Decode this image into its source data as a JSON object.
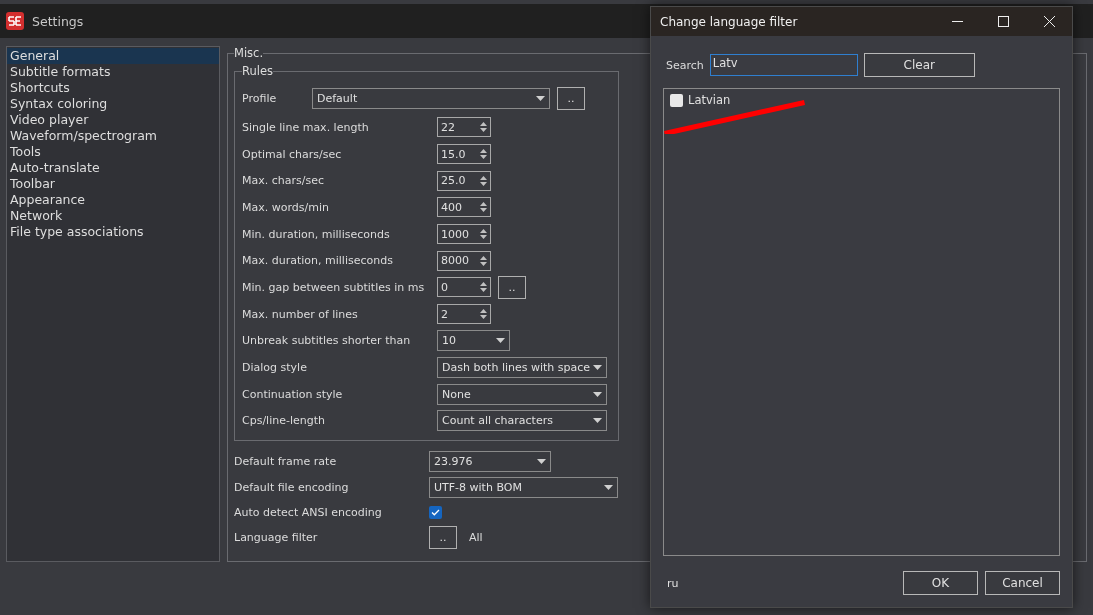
{
  "window": {
    "title": "Settings"
  },
  "sidebar": {
    "items": [
      {
        "label": "General",
        "selected": true
      },
      {
        "label": "Subtitle formats",
        "selected": false
      },
      {
        "label": "Shortcuts",
        "selected": false
      },
      {
        "label": "Syntax coloring",
        "selected": false
      },
      {
        "label": "Video player",
        "selected": false
      },
      {
        "label": "Waveform/spectrogram",
        "selected": false
      },
      {
        "label": "Tools",
        "selected": false
      },
      {
        "label": "Auto-translate",
        "selected": false
      },
      {
        "label": "Toolbar",
        "selected": false
      },
      {
        "label": "Appearance",
        "selected": false
      },
      {
        "label": "Network",
        "selected": false
      },
      {
        "label": "File type associations",
        "selected": false
      }
    ]
  },
  "misc": {
    "title": "Misc.",
    "rules": {
      "title": "Rules",
      "profile": {
        "label": "Profile",
        "value": "Default",
        "button": ".."
      },
      "rows": [
        {
          "kind": "spin",
          "label": "Single line max. length",
          "value": "22"
        },
        {
          "kind": "spin",
          "label": "Optimal chars/sec",
          "value": "15.0"
        },
        {
          "kind": "spin",
          "label": "Max. chars/sec",
          "value": "25.0"
        },
        {
          "kind": "spin",
          "label": "Max. words/min",
          "value": "400"
        },
        {
          "kind": "spin",
          "label": "Min. duration, milliseconds",
          "value": "1000"
        },
        {
          "kind": "spin",
          "label": "Max. duration, milliseconds",
          "value": "8000"
        },
        {
          "kind": "spin",
          "label": "Min. gap between subtitles in ms",
          "value": "0",
          "button": ".."
        },
        {
          "kind": "spin",
          "label": "Max. number of lines",
          "value": "2"
        },
        {
          "kind": "combo-small",
          "label": "Unbreak subtitles shorter than",
          "value": "10"
        },
        {
          "kind": "combo",
          "label": "Dialog style",
          "value": "Dash both lines with space"
        },
        {
          "kind": "combo",
          "label": "Continuation style",
          "value": "None"
        },
        {
          "kind": "combo",
          "label": "Cps/line-length",
          "value": "Count all characters"
        }
      ]
    },
    "rows": [
      {
        "kind": "combo-medium",
        "label": "Default frame rate",
        "value": "23.976"
      },
      {
        "kind": "combo-wide",
        "label": "Default file encoding",
        "value": "UTF-8 with BOM"
      },
      {
        "kind": "checkbox",
        "label": "Auto detect ANSI encoding",
        "checked": true
      },
      {
        "kind": "button",
        "label": "Language filter",
        "button": "..",
        "value": "All"
      }
    ]
  },
  "dialog": {
    "title": "Change language filter",
    "search": {
      "label": "Search",
      "value": "Latv"
    },
    "clear": "Clear",
    "languages": [
      {
        "label": "Latvian",
        "checked": false
      }
    ],
    "code": "ru",
    "buttons": [
      "OK",
      "Cancel"
    ]
  }
}
